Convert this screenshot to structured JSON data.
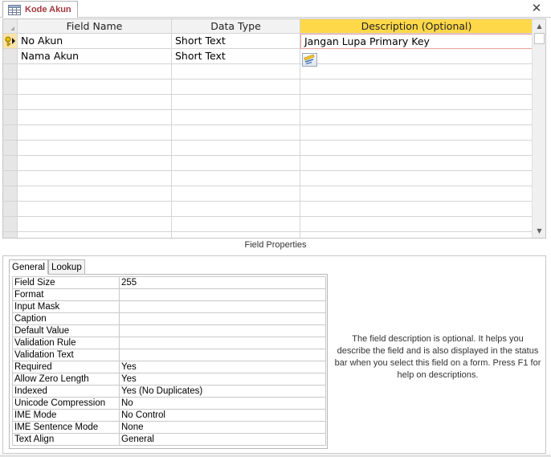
{
  "tab": {
    "title": "Kode Akun",
    "icon": "table-icon",
    "close": "✕"
  },
  "colors": {
    "selected_header": "#ffd84a",
    "tab_text": "#a4373a",
    "current_row": "#fbe4a6"
  },
  "grid": {
    "columns": [
      "Field Name",
      "Data Type",
      "Description (Optional)"
    ],
    "rows": [
      {
        "field": "No Akun",
        "type": "Short Text",
        "description": "Jangan Lupa Primary Key",
        "primary_key": true
      },
      {
        "field": "Nama Akun",
        "type": "Short Text",
        "description": ""
      }
    ]
  },
  "field_properties": {
    "caption": "Field Properties",
    "tabs": [
      "General",
      "Lookup"
    ],
    "active_tab": "General",
    "properties": [
      {
        "name": "Field Size",
        "value": "255"
      },
      {
        "name": "Format",
        "value": ""
      },
      {
        "name": "Input Mask",
        "value": ""
      },
      {
        "name": "Caption",
        "value": ""
      },
      {
        "name": "Default Value",
        "value": ""
      },
      {
        "name": "Validation Rule",
        "value": ""
      },
      {
        "name": "Validation Text",
        "value": ""
      },
      {
        "name": "Required",
        "value": "Yes"
      },
      {
        "name": "Allow Zero Length",
        "value": "Yes"
      },
      {
        "name": "Indexed",
        "value": "Yes (No Duplicates)"
      },
      {
        "name": "Unicode Compression",
        "value": "No"
      },
      {
        "name": "IME Mode",
        "value": "No Control"
      },
      {
        "name": "IME Sentence Mode",
        "value": "None"
      },
      {
        "name": "Text Align",
        "value": "General"
      }
    ],
    "help": "The field description is optional. It helps you describe the field and is also displayed in the status bar when you select this field on a form. Press F1 for help on descriptions."
  }
}
